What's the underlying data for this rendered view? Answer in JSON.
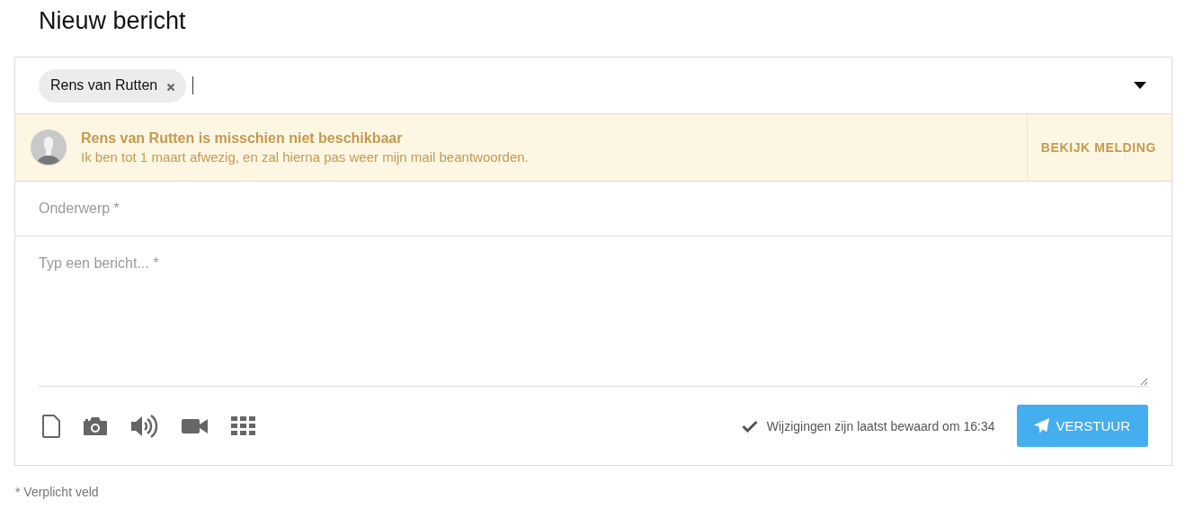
{
  "title": "Nieuw bericht",
  "recipients": [
    {
      "name": "Rens van Rutten"
    }
  ],
  "notice": {
    "title": "Rens van Rutten is misschien niet beschikbaar",
    "message": "Ik ben tot 1 maart afwezig, en zal hierna pas weer mijn mail beantwoorden.",
    "action": "BEKIJK MELDING"
  },
  "subject": {
    "placeholder": "Onderwerp *"
  },
  "message": {
    "placeholder": "Typ een bericht... *"
  },
  "save_status": "Wijzigingen zijn laatst bewaard om 16:34",
  "send_button": "VERSTUUR",
  "footnote": "* Verplicht veld"
}
